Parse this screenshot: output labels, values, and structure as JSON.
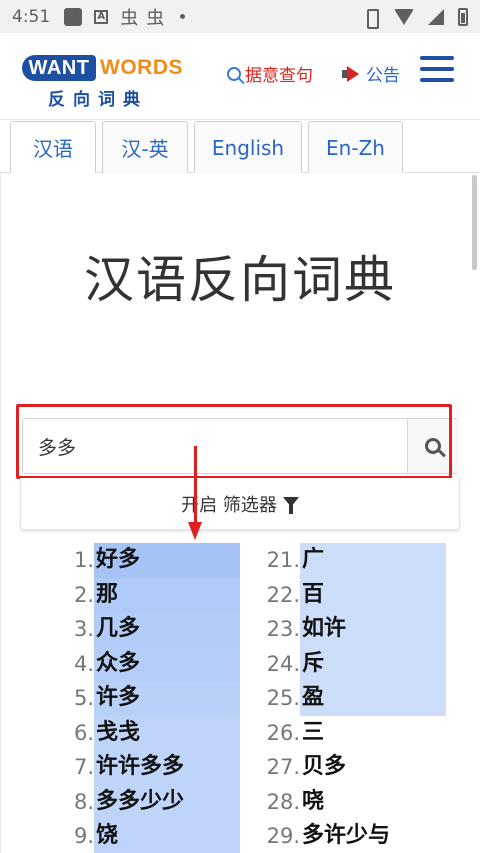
{
  "status_bar": {
    "time": "4:51",
    "bug1": "虫",
    "bug2": "虫",
    "a_icon": "A"
  },
  "header": {
    "logo_want": "WANT",
    "logo_words": "WORDS",
    "logo_cn": "反向词典",
    "reverse_search_label": "据意查句",
    "announce_label": "公告",
    "icons": [
      "search-icon",
      "megaphone-icon",
      "menu-icon"
    ]
  },
  "tabs": [
    {
      "label": "汉语",
      "active": true
    },
    {
      "label": "汉-英",
      "active": false
    },
    {
      "label": "English",
      "active": false
    },
    {
      "label": "En-Zh",
      "active": false
    }
  ],
  "main": {
    "title": "汉语反向词典",
    "search": {
      "value": "多多",
      "placeholder": ""
    },
    "filter_label": "开启 筛选器"
  },
  "results_left": [
    {
      "n": "1.",
      "w": "好多",
      "shade": 1.0
    },
    {
      "n": "2.",
      "w": "那",
      "shade": 0.85
    },
    {
      "n": "3.",
      "w": "几多",
      "shade": 0.8
    },
    {
      "n": "4.",
      "w": "众多",
      "shade": 0.75
    },
    {
      "n": "5.",
      "w": "许多",
      "shade": 0.7
    },
    {
      "n": "6.",
      "w": "戋戋",
      "shade": 0.6
    },
    {
      "n": "7.",
      "w": "许许多多",
      "shade": 0.6
    },
    {
      "n": "8.",
      "w": "多多少少",
      "shade": 0.6
    },
    {
      "n": "9.",
      "w": "饶",
      "shade": 0.6
    }
  ],
  "results_right": [
    {
      "n": "21.",
      "w": "广",
      "shade": 0.4
    },
    {
      "n": "22.",
      "w": "百",
      "shade": 0.4
    },
    {
      "n": "23.",
      "w": "如许",
      "shade": 0.4
    },
    {
      "n": "24.",
      "w": "斥",
      "shade": 0.4
    },
    {
      "n": "25.",
      "w": "盈",
      "shade": 0.4
    },
    {
      "n": "26.",
      "w": "三",
      "shade": 0
    },
    {
      "n": "27.",
      "w": "贝多",
      "shade": 0
    },
    {
      "n": "28.",
      "w": "哓",
      "shade": 0
    },
    {
      "n": "29.",
      "w": "多许少与",
      "shade": 0
    }
  ],
  "colors": {
    "accent": "#1f4fa3",
    "highlight": "#e02020",
    "result_bg": "#b9cdf5"
  }
}
